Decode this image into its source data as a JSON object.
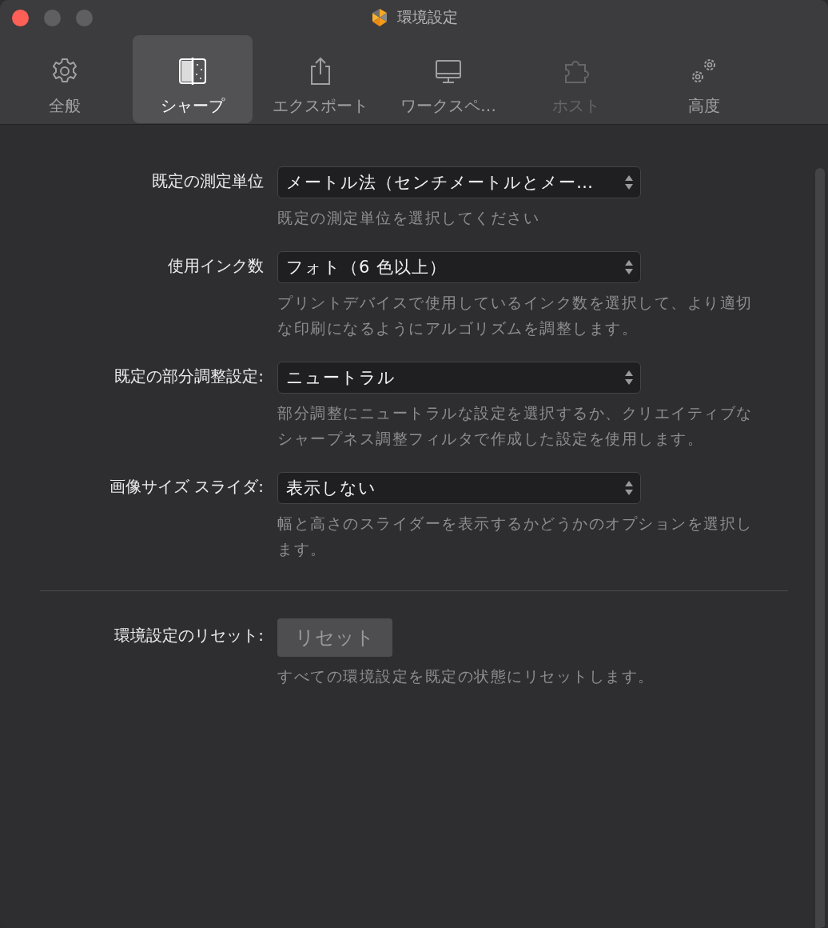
{
  "window": {
    "title": "環境設定"
  },
  "tabs": [
    {
      "label": "全般",
      "kind": "gear",
      "selected": false,
      "disabled": false
    },
    {
      "label": "シャープ",
      "kind": "sharpen",
      "selected": true,
      "disabled": false
    },
    {
      "label": "エクスポート",
      "kind": "share",
      "selected": false,
      "disabled": false
    },
    {
      "label": "ワークスペ…",
      "kind": "monitor",
      "selected": false,
      "disabled": false
    },
    {
      "label": "ホスト",
      "kind": "puzzle",
      "selected": false,
      "disabled": true
    },
    {
      "label": "高度",
      "kind": "gears",
      "selected": false,
      "disabled": false
    }
  ],
  "settings": [
    {
      "label": "既定の測定単位",
      "value": "メートル法（センチメートルとメー…",
      "description": "既定の測定単位を選択してください"
    },
    {
      "label": "使用インク数",
      "value": "フォト（6 色以上）",
      "description": "プリントデバイスで使用しているインク数を選択して、より適切な印刷になるようにアルゴリズムを調整します。"
    },
    {
      "label": "既定の部分調整設定:",
      "value": "ニュートラル",
      "description": "部分調整にニュートラルな設定を選択するか、クリエイティブなシャープネス調整フィルタで作成した設定を使用します。"
    },
    {
      "label": "画像サイズ スライダ:",
      "value": "表示しない",
      "description": "幅と高さのスライダーを表示するかどうかのオプションを選択します。"
    }
  ],
  "reset": {
    "label": "環境設定のリセット:",
    "button": "リセット",
    "description": "すべての環境設定を既定の状態にリセットします。"
  }
}
